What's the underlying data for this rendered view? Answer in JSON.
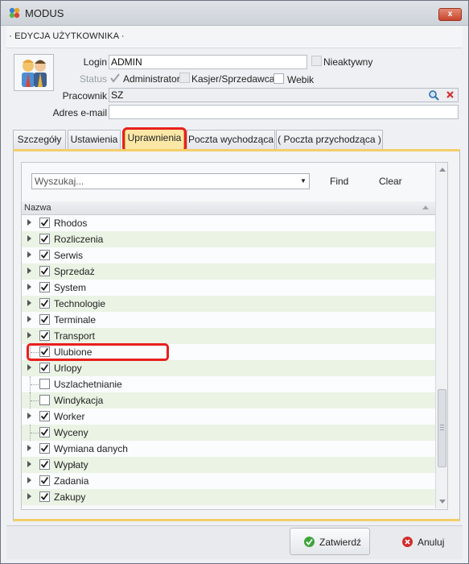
{
  "window": {
    "title": "MODUS",
    "close_label": "x"
  },
  "header": {
    "title": "· EDYCJA UŻYTKOWNIKA ·"
  },
  "form": {
    "login_label": "Login",
    "login_value": "ADMIN",
    "inactive_label": "Nieaktywny",
    "status_label": "Status",
    "status_options": [
      "Administrator",
      "Kasjer/Sprzedawca",
      "Webik"
    ],
    "employee_label": "Pracownik",
    "employee_value": "SZ",
    "email_label": "Adres e-mail",
    "email_value": ""
  },
  "tabs": [
    "Szczegóły",
    "Ustawienia",
    "Uprawnienia",
    "Poczta wychodząca",
    "( Poczta przychodząca )"
  ],
  "active_tab": "Uprawnienia",
  "permissions": {
    "search_placeholder": "Wyszukaj...",
    "find_label": "Find",
    "clear_label": "Clear",
    "column_header": "Nazwa",
    "items": [
      {
        "name": "Rhodos",
        "checked": true,
        "expandable": true
      },
      {
        "name": "Rozliczenia",
        "checked": true,
        "expandable": true
      },
      {
        "name": "Serwis",
        "checked": true,
        "expandable": true
      },
      {
        "name": "Sprzedaż",
        "checked": true,
        "expandable": true
      },
      {
        "name": "System",
        "checked": true,
        "expandable": true
      },
      {
        "name": "Technologie",
        "checked": true,
        "expandable": true
      },
      {
        "name": "Terminale",
        "checked": true,
        "expandable": true
      },
      {
        "name": "Transport",
        "checked": true,
        "expandable": true
      },
      {
        "name": "Ulubione",
        "checked": true,
        "expandable": false
      },
      {
        "name": "Urlopy",
        "checked": true,
        "expandable": true
      },
      {
        "name": "Uszlachetnianie",
        "checked": false,
        "expandable": false
      },
      {
        "name": "Windykacja",
        "checked": false,
        "expandable": false
      },
      {
        "name": "Worker",
        "checked": true,
        "expandable": true
      },
      {
        "name": "Wyceny",
        "checked": true,
        "expandable": false
      },
      {
        "name": "Wymiana danych",
        "checked": true,
        "expandable": true
      },
      {
        "name": "Wypłaty",
        "checked": true,
        "expandable": true
      },
      {
        "name": "Zadania",
        "checked": true,
        "expandable": true
      },
      {
        "name": "Zakupy",
        "checked": true,
        "expandable": true
      }
    ]
  },
  "footer": {
    "confirm_label": "Zatwierdź",
    "cancel_label": "Anuluj"
  },
  "colors": {
    "accent_tab": "#fbe7a6",
    "highlight": "#e8201c",
    "confirm_icon": "#3da53a",
    "cancel_icon": "#d42a2a"
  }
}
